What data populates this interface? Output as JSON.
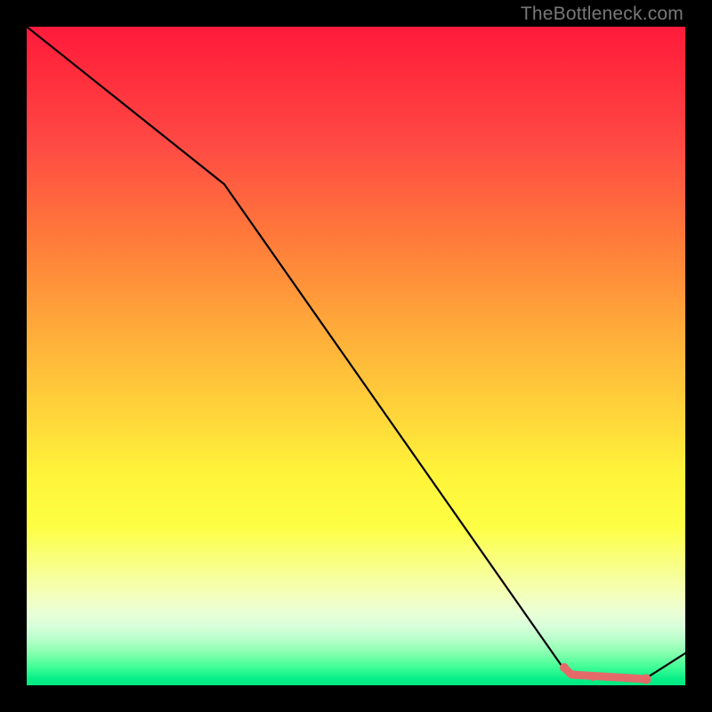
{
  "watermark": "TheBottleneck.com",
  "chart_data": {
    "type": "line",
    "title": "",
    "xlabel": "",
    "ylabel": "",
    "x": [
      0,
      30,
      82,
      87,
      94,
      100
    ],
    "y": [
      100,
      76,
      1.5,
      1.0,
      1.0,
      4
    ],
    "xlim": [
      0,
      100
    ],
    "ylim": [
      0,
      100
    ],
    "grid": false,
    "legend": false,
    "highlight_band_y": [
      0,
      4
    ],
    "highlight_points_x_range": [
      82,
      94
    ],
    "colors": {
      "line": "#000000",
      "highlight": "#e86464",
      "gradient_top": "#ff1a3c",
      "gradient_bottom": "#00e880"
    }
  }
}
